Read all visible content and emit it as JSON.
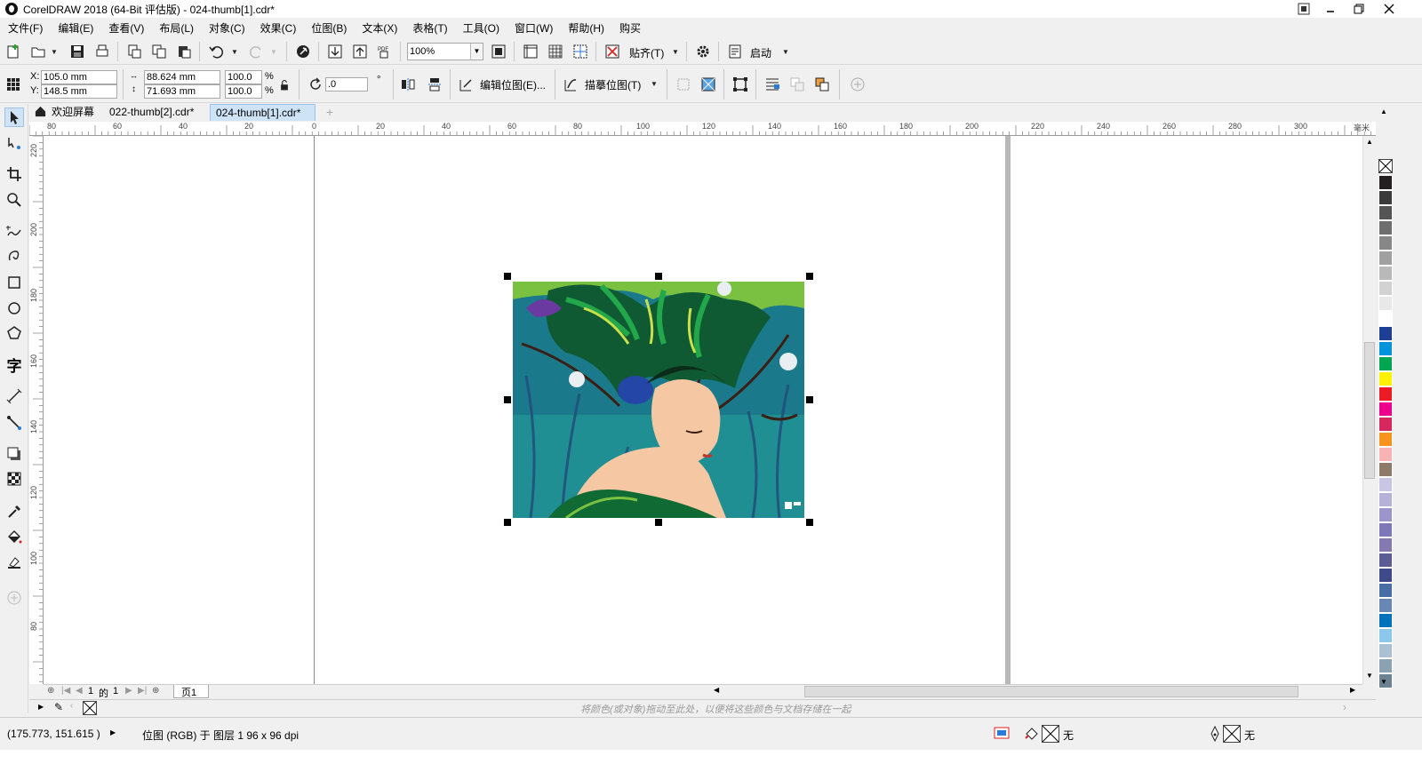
{
  "window": {
    "title": "CorelDRAW 2018 (64-Bit 评估版) - 024-thumb[1].cdr*"
  },
  "menu": [
    "文件(F)",
    "编辑(E)",
    "查看(V)",
    "布局(L)",
    "对象(C)",
    "效果(C)",
    "位图(B)",
    "文本(X)",
    "表格(T)",
    "工具(O)",
    "窗口(W)",
    "帮助(H)",
    "购买"
  ],
  "toolbar": {
    "zoom_value": "100%",
    "snap_label": "贴齐(T)",
    "launch_label": "启动"
  },
  "property_bar": {
    "x_label": "X:",
    "y_label": "Y:",
    "x_value": "105.0 mm",
    "y_value": "148.5 mm",
    "width_value": "88.624 mm",
    "height_value": "71.693 mm",
    "scale_w": "100.0",
    "scale_h": "100.0",
    "percent": "%",
    "rotation": ".0",
    "degree": "°",
    "edit_bitmap_label": "编辑位图(E)...",
    "trace_bitmap_label": "描摹位图(T)"
  },
  "tabs": [
    {
      "label": "欢迎屏幕",
      "active": false
    },
    {
      "label": "022-thumb[2].cdr*",
      "active": false
    },
    {
      "label": "024-thumb[1].cdr*",
      "active": true
    }
  ],
  "ruler": {
    "h_labels": [
      "80",
      "60",
      "40",
      "20",
      "0",
      "20",
      "40",
      "60",
      "80",
      "100",
      "120",
      "140",
      "160",
      "180",
      "200",
      "220",
      "240",
      "260",
      "280",
      "300"
    ],
    "h_unit": "毫米",
    "v_labels": [
      "220",
      "200",
      "180",
      "160",
      "140",
      "120",
      "100",
      "80"
    ]
  },
  "page_nav": {
    "current": "1",
    "of": "的",
    "total": "1",
    "page_tab": "页1"
  },
  "color_bar": {
    "hint": "将颜色(或对象)拖动至此处，以便将这些颜色与文档存储在一起"
  },
  "status": {
    "coords": "(175.773, 151.615 )",
    "object_info": "位图 (RGB) 于 图层 1 96 x 96 dpi",
    "fill_none": "无",
    "outline_none": "无"
  },
  "palette_colors": [
    "#231f20",
    "#3b3b3b",
    "#555555",
    "#6e6e6e",
    "#878787",
    "#a0a0a0",
    "#b9b9b9",
    "#d2d2d2",
    "#e8e8e8",
    "#ffffff",
    "#1d3f95",
    "#0093dd",
    "#00a650",
    "#fff200",
    "#ed1c24",
    "#ec008c",
    "#d7275f",
    "#f7941d",
    "#f9b3b3",
    "#8c7b6b",
    "#c9c6e5",
    "#b6b1d8",
    "#9b95c9",
    "#7f78b8",
    "#847aaf",
    "#5d5b96",
    "#3e4a8a",
    "#476ea5",
    "#6987b5",
    "#0072bc",
    "#8cc8eb",
    "#a9c1d2",
    "#8aa2b2",
    "#6c8291"
  ]
}
